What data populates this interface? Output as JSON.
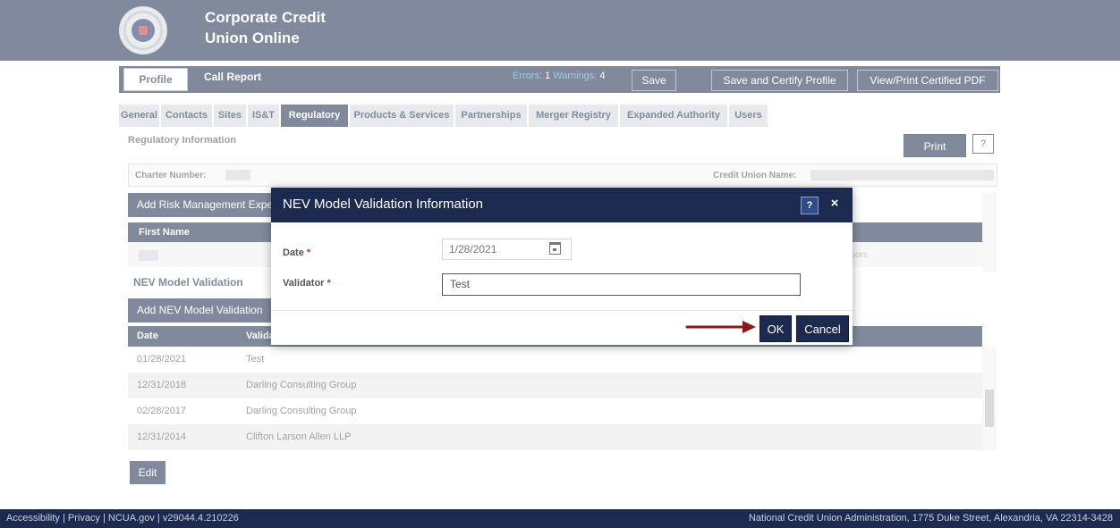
{
  "app": {
    "title": "Corporate Credit Union Online"
  },
  "topnav": {
    "profile_tab": "Profile",
    "call_report_tab": "Call Report",
    "errors_label": "Errors:",
    "errors_count": "1",
    "warnings_label": "Warnings:",
    "warnings_count": "4",
    "save_button": "Save",
    "save_certify_button": "Save and Certify Profile",
    "view_print_button": "View/Print Certified PDF"
  },
  "subnav": {
    "tabs": [
      {
        "label": "General"
      },
      {
        "label": "Contacts"
      },
      {
        "label": "Sites"
      },
      {
        "label": "IS&T"
      },
      {
        "label": "Regulatory"
      },
      {
        "label": "Products & Services"
      },
      {
        "label": "Partnerships"
      },
      {
        "label": "Merger Registry"
      },
      {
        "label": "Expanded Authority"
      },
      {
        "label": "Users"
      }
    ],
    "active": "Regulatory"
  },
  "page": {
    "section_title": "Regulatory Information",
    "print_button": "Print",
    "help_button": "?",
    "charter_label": "Charter Number:",
    "cu_name_label": "Credit Union Name:"
  },
  "risk_section": {
    "add_button": "Add Risk Management Expert",
    "first_name_header": "First Name",
    "row_fragment": "sors"
  },
  "nev_section": {
    "title": "NEV Model Validation",
    "add_button": "Add NEV Model Validation",
    "headers": {
      "date": "Date",
      "validator": "Validator"
    },
    "rows": [
      {
        "date": "01/28/2021",
        "validator": "Test"
      },
      {
        "date": "12/31/2018",
        "validator": "Darling Consulting Group"
      },
      {
        "date": "02/28/2017",
        "validator": "Darling Consulting Group"
      },
      {
        "date": "12/31/2014",
        "validator": "Clifton Larson Allen LLP"
      }
    ],
    "edit_button": "Edit"
  },
  "modal": {
    "title": "NEV Model Validation Information",
    "help": "?",
    "close": "×",
    "date_label": "Date",
    "date_value": "1/28/2021",
    "validator_label": "Validator",
    "validator_value": "Test",
    "required_mark": "*",
    "ok_button": "OK",
    "cancel_button": "Cancel"
  },
  "footer": {
    "left": "Accessibility | Privacy | NCUA.gov | v29044.4.210226",
    "right": "National Credit Union Administration, 1775 Duke Street, Alexandria, VA 22314-3428"
  },
  "colors": {
    "navy": "#1b2a4e",
    "link_blue": "#4aa3df",
    "required_red": "#c0392b",
    "arrow_red": "#8b1a1a"
  }
}
